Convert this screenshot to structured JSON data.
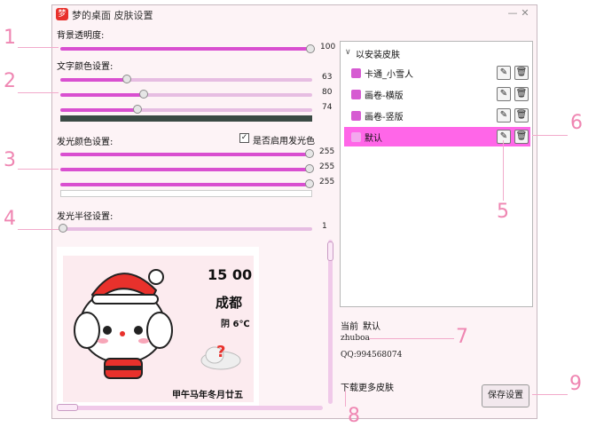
{
  "window": {
    "title": "梦的桌面 皮肤设置",
    "icon": "app-logo-icon",
    "minimize": "—",
    "close": "✕"
  },
  "settings": {
    "bg_opacity": {
      "label": "背景透明度:",
      "value": "100"
    },
    "text_color": {
      "label": "文字颜色设置:",
      "r": "63",
      "g": "80",
      "b": "74",
      "swatch": "#3a4a44"
    },
    "glow_color": {
      "label": "发光颜色设置:",
      "enable_label": "是否启用发光色",
      "enable_checked": true,
      "r": "255",
      "g": "255",
      "b": "255",
      "swatch": "#ffffff"
    },
    "glow_radius": {
      "label": "发光半径设置:",
      "value": "1"
    }
  },
  "preview": {
    "time": "15 00",
    "city": "成都",
    "weather": "阴 6℃",
    "date": "甲午马年冬月廿五"
  },
  "skins": {
    "group_label": "以安装皮肤",
    "items": [
      {
        "name": "卡通_小雪人",
        "selected": false
      },
      {
        "name": "画卷-横版",
        "selected": false
      },
      {
        "name": "画卷-竖版",
        "selected": false
      },
      {
        "name": "默认",
        "selected": true
      }
    ],
    "edit_icon": "✎",
    "delete_icon": "🗑"
  },
  "info": {
    "current_label": "当前",
    "current_value": "默认",
    "author": "zhuboa",
    "qq": "QQ:994568074"
  },
  "download_link": "下载更多皮肤",
  "save_button": "保存设置",
  "annotations": [
    "1",
    "2",
    "3",
    "4",
    "5",
    "6",
    "7",
    "8",
    "9"
  ],
  "colors": {
    "accent": "#d94fd0",
    "selected_row": "#ff66e8",
    "annotation": "#ef86b2"
  }
}
